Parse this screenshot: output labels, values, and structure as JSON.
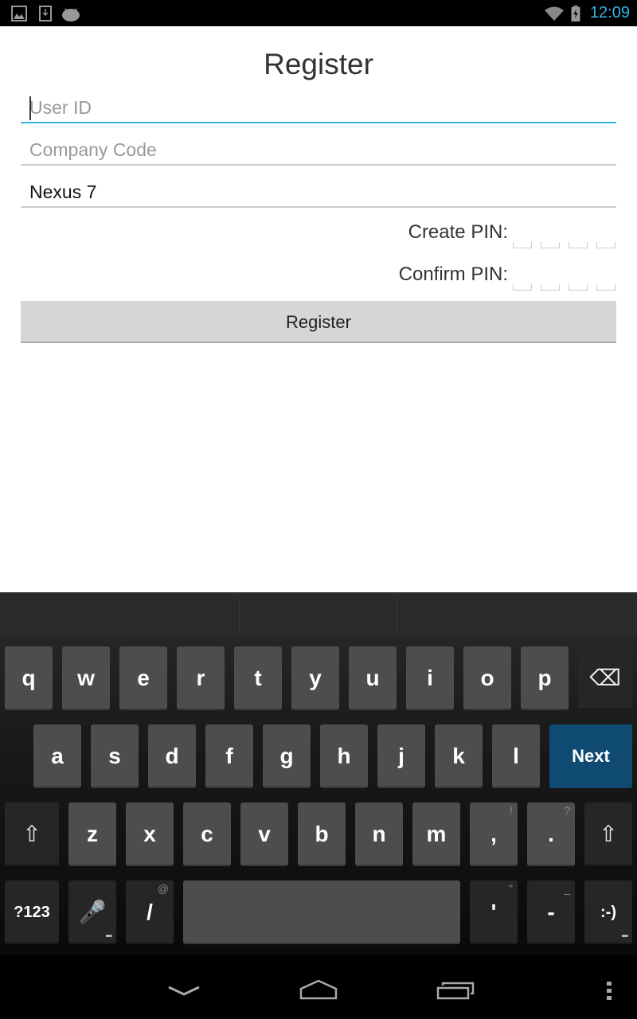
{
  "status_bar": {
    "time": "12:09",
    "icons": [
      "gallery-icon",
      "download-icon",
      "android-icon",
      "wifi-icon",
      "battery-charging-icon"
    ],
    "clock_color": "#33b5e5"
  },
  "form": {
    "title": "Register",
    "user_id": {
      "placeholder": "User ID",
      "value": ""
    },
    "company_code": {
      "placeholder": "Company Code",
      "value": ""
    },
    "device_name": {
      "value": "Nexus 7"
    },
    "create_pin_label": "Create PIN:",
    "confirm_pin_label": "Confirm PIN:",
    "register_button": "Register"
  },
  "keyboard": {
    "rows": [
      [
        {
          "k": "q"
        },
        {
          "k": "w"
        },
        {
          "k": "e"
        },
        {
          "k": "r"
        },
        {
          "k": "t"
        },
        {
          "k": "y"
        },
        {
          "k": "u"
        },
        {
          "k": "i"
        },
        {
          "k": "o"
        },
        {
          "k": "p"
        },
        {
          "k": "⌫",
          "name": "backspace"
        }
      ],
      [
        {
          "k": "a"
        },
        {
          "k": "s"
        },
        {
          "k": "d"
        },
        {
          "k": "f"
        },
        {
          "k": "g"
        },
        {
          "k": "h"
        },
        {
          "k": "j"
        },
        {
          "k": "k"
        },
        {
          "k": "l"
        },
        {
          "k": "Next",
          "name": "next"
        }
      ],
      [
        {
          "k": "⇧",
          "name": "shift-left"
        },
        {
          "k": "z"
        },
        {
          "k": "x"
        },
        {
          "k": "c"
        },
        {
          "k": "v"
        },
        {
          "k": "b"
        },
        {
          "k": "n"
        },
        {
          "k": "m"
        },
        {
          "k": ",",
          "hint": "!"
        },
        {
          "k": ".",
          "hint": "?"
        },
        {
          "k": "⇧",
          "name": "shift-right"
        }
      ],
      [
        {
          "k": "?123",
          "name": "symbols"
        },
        {
          "k": "🎤",
          "name": "mic"
        },
        {
          "k": "/",
          "hint": "@"
        },
        {
          "k": "",
          "name": "space"
        },
        {
          "k": "'",
          "hint": "\""
        },
        {
          "k": "-",
          "hint": "_"
        },
        {
          "k": ":-)",
          "name": "emoticon"
        }
      ]
    ],
    "accent": "#0e4a72"
  },
  "nav_bar": {
    "icons": [
      "hide-keyboard-icon",
      "home-icon",
      "recent-apps-icon",
      "menu-icon"
    ]
  }
}
